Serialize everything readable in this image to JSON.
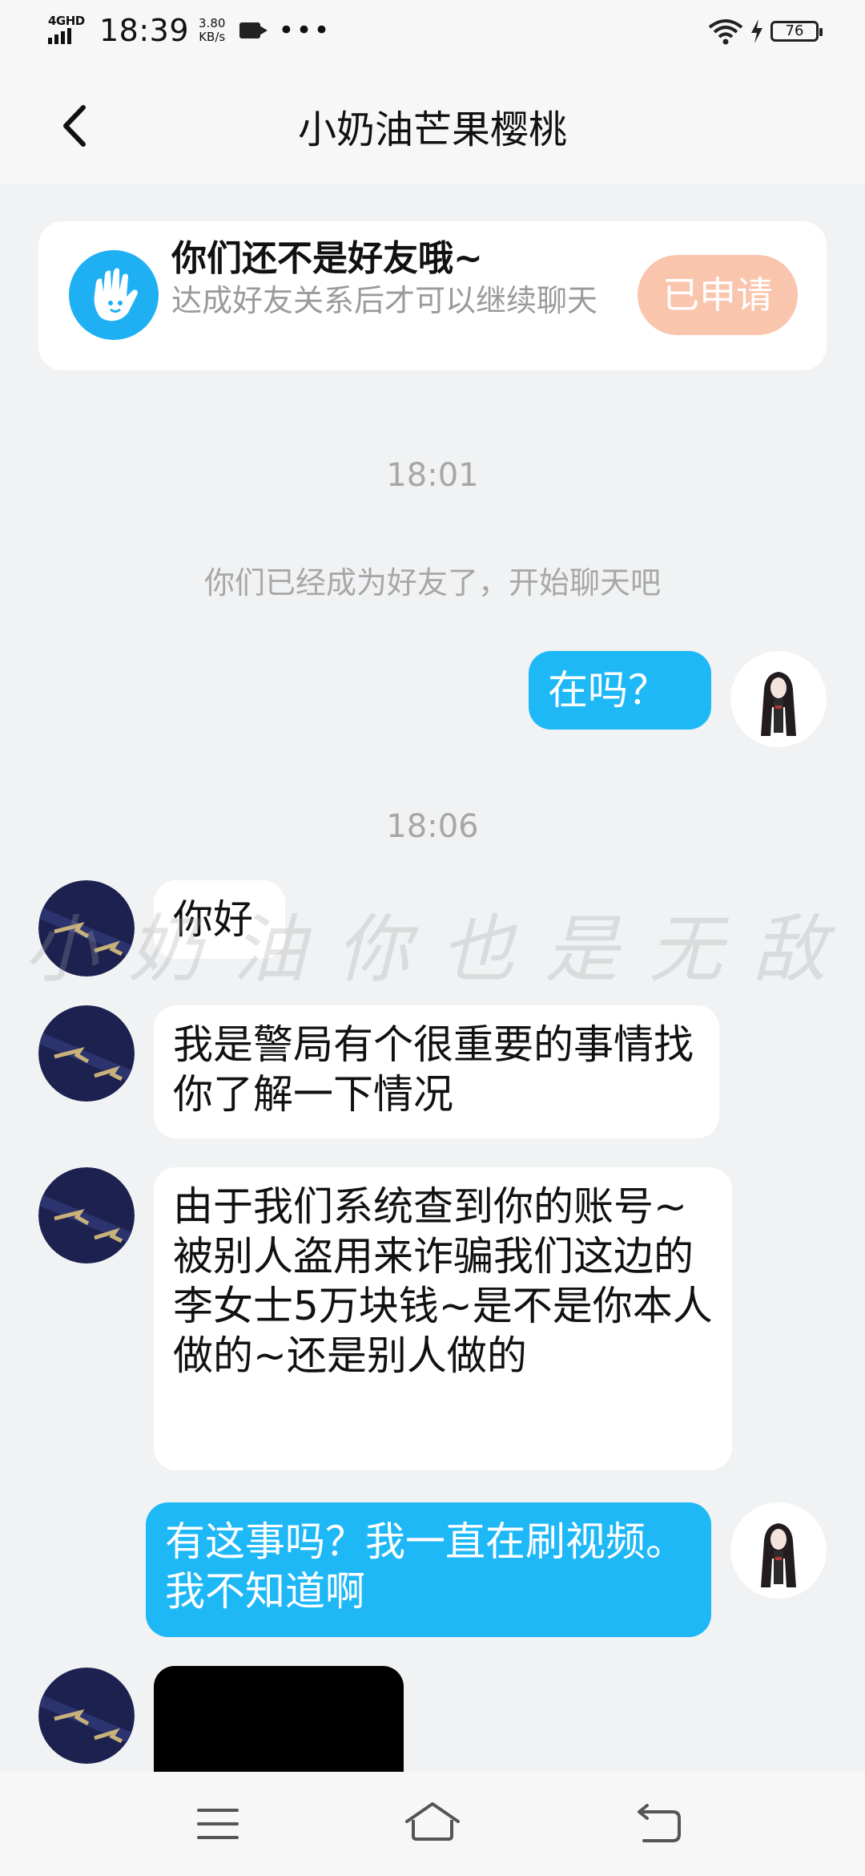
{
  "status_bar": {
    "network": "4GHD",
    "time": "18:39",
    "speed_value": "3.80",
    "speed_unit": "KB/s",
    "dots": "•••",
    "battery": "76",
    "icons": [
      "signal-icon",
      "video-icon",
      "wifi-icon",
      "charging-icon",
      "battery-icon"
    ]
  },
  "header": {
    "title": "小奶油芒果樱桃",
    "back_icon": "chevron-left-icon"
  },
  "friend_card": {
    "title": "你们还不是好友哦~",
    "description": "达成好友关系后才可以继续聊天",
    "button_label": "已申请",
    "icon": "hand-icon",
    "colors": {
      "icon_bg": "#1fb0f4",
      "button_bg": "#f9c5ad"
    }
  },
  "chat": {
    "timestamp_1": "18:01",
    "system_message": "你们已经成为好友了，开始聊天吧",
    "message_1": "在吗？",
    "timestamp_2": "18:06",
    "message_2": "你好",
    "message_3": "我是警局有个很重要的事情找你了解一下情况",
    "message_4": "由于我们系统查到你的账号~被别人盗用来诈骗我们这边的李女士5万块钱~是不是你本人做的~还是别人做的",
    "message_5": "有这事吗？我一直在刷视频。我不知道啊",
    "watermark": "小奶油你也是无敌了啊",
    "colors": {
      "outgoing_bubble": "#1fb8f7",
      "incoming_bubble": "#ffffff"
    }
  },
  "navbar": {
    "icons": [
      "menu-icon",
      "home-icon",
      "back-icon"
    ]
  }
}
